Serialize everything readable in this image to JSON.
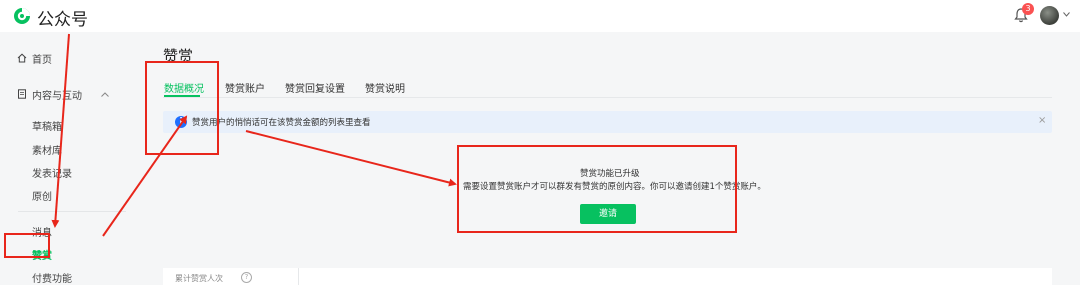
{
  "header": {
    "brand": "公众号",
    "notification_count": "3"
  },
  "sidebar": {
    "home": "首页",
    "content_group": "内容与互动",
    "items": [
      "草稿箱",
      "素材库",
      "发表记录",
      "原创",
      "消息",
      "赞赏",
      "付费功能"
    ]
  },
  "main": {
    "title": "赞赏",
    "tabs": [
      "数据概况",
      "赞赏账户",
      "赞赏回复设置",
      "赞赏说明"
    ],
    "active_tab": "数据概况",
    "notice": "赞赏用户的悄悄话可在该赞赏金额的列表里查看",
    "notice_close": "×",
    "upgrade_title": "赞赏功能已升级",
    "upgrade_desc": "需要设置赞赏账户才可以群发有赞赏的原创内容。你可以邀请创建1个赞赏账户。",
    "invite_button": "邀请",
    "bottom_label": "累计赞赏人次"
  },
  "colors": {
    "accent": "#07c160",
    "annotation": "#e8261b",
    "notice_bg": "#e8f0fb",
    "info": "#1e6fff"
  },
  "icons": [
    "logo-icon",
    "bell-icon",
    "home-icon",
    "document-icon",
    "chevron-up-icon",
    "info-icon",
    "close-icon",
    "help-icon",
    "chevron-down-icon"
  ]
}
